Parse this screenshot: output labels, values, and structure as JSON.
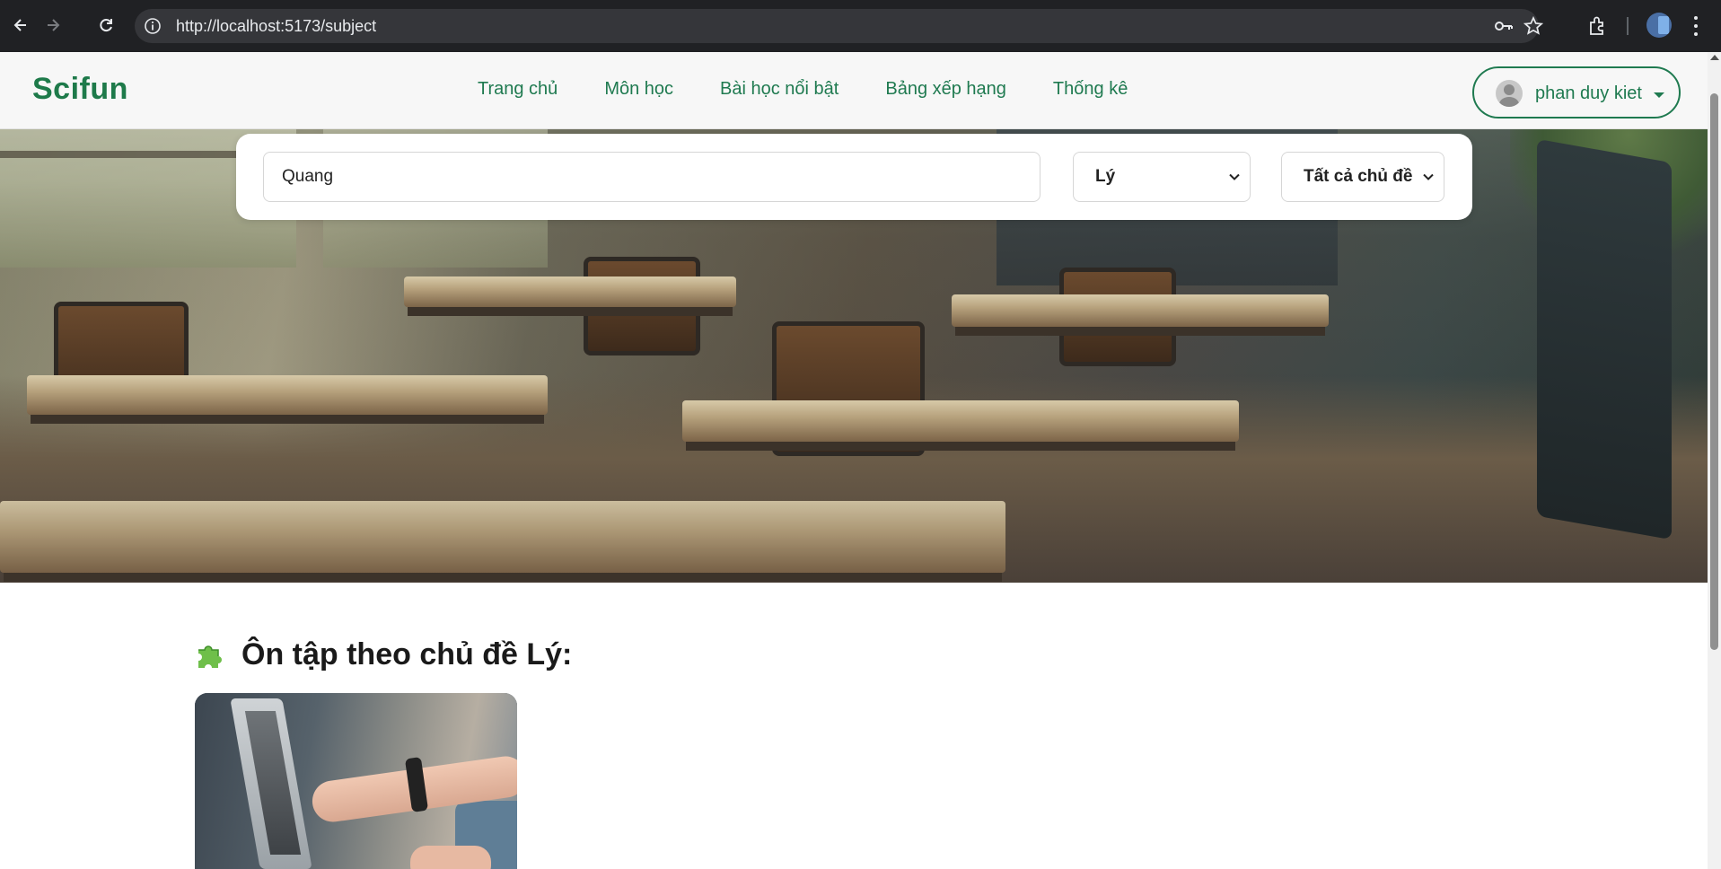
{
  "browser": {
    "url": "http://localhost:5173/subject"
  },
  "navbar": {
    "brand": "Scifun",
    "links": [
      "Trang chủ",
      "Môn học",
      "Bài học nổi bật",
      "Bảng xếp hạng",
      "Thống kê"
    ],
    "user_name": "phan duy kiet"
  },
  "search": {
    "query": "Quang",
    "subject_selected": "Lý",
    "topic_selected": "Tất cả chủ đề"
  },
  "section": {
    "title": "Ôn tập theo chủ đề Lý:"
  },
  "colors": {
    "brand_green": "#1e7a4a",
    "link_green": "#1f7a50",
    "chrome_dark": "#202124"
  }
}
